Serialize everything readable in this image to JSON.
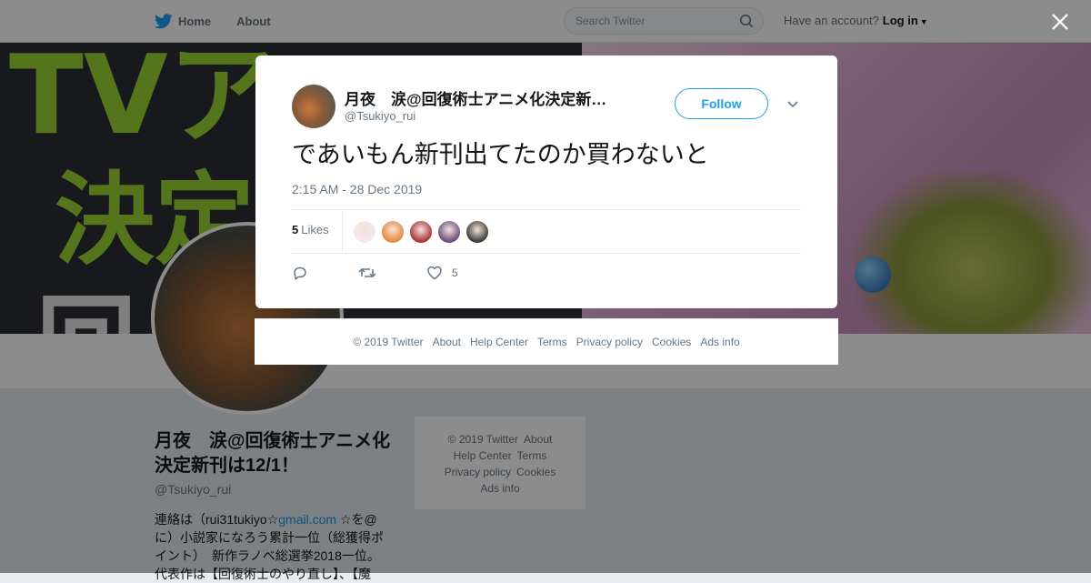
{
  "nav": {
    "home_label": "Home",
    "about_label": "About",
    "search_placeholder": "Search Twitter",
    "have_account": "Have an account?",
    "login_label": "Log in"
  },
  "banner": {
    "text_line1": "TVア",
    "text_line2": "決定",
    "text_line3": "回"
  },
  "profile": {
    "name": "月夜　涙@回復術士アニメ化決定新刊は12/1！",
    "handle": "@Tsukiyo_rui",
    "bio_prefix": "連絡は（rui31tukiyo☆",
    "bio_link": "gmail.com",
    "bio_rest": " ☆を@に）小説家になろう累計一位（総獲得ポイント）　新作ラノベ総選挙2018一位。代表作は【回復術士のやり直し】、【魔"
  },
  "side_footer": {
    "copyright": "© 2019 Twitter",
    "about": "About",
    "help": "Help Center",
    "terms": "Terms",
    "privacy": "Privacy policy",
    "cookies": "Cookies",
    "ads": "Ads info"
  },
  "tweet": {
    "author_name": "月夜　涙@回復術士アニメ化決定新…",
    "author_handle": "@Tsukiyo_rui",
    "follow_label": "Follow",
    "text": "であいもん新刊出てたのか買わないと",
    "timestamp": "2:15 AM - 28 Dec 2019",
    "likes_count": "5",
    "likes_label": "Likes",
    "like_action_count": "5",
    "liker_colors": [
      "#f4e8ee",
      "#e8893a",
      "#a8323a",
      "#6a4c7c",
      "#3d3a36"
    ]
  },
  "modal_footer": {
    "copyright": "© 2019 Twitter",
    "about": "About",
    "help": "Help Center",
    "terms": "Terms",
    "privacy": "Privacy policy",
    "cookies": "Cookies",
    "ads": "Ads info"
  },
  "colors": {
    "accent": "#1da1f2",
    "banner_green": "#9bd636"
  }
}
